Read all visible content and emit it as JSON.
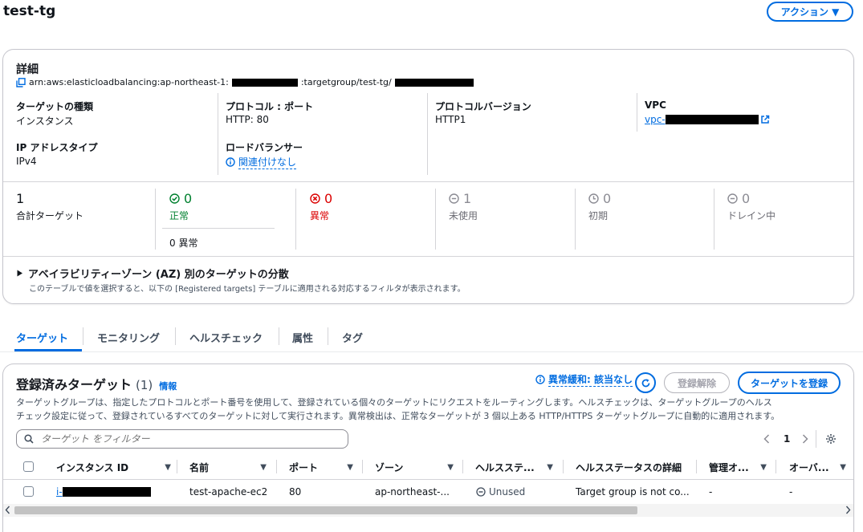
{
  "page": {
    "title": "test-tg",
    "actions_button": "アクション ▼"
  },
  "details": {
    "heading": "詳細",
    "arn_prefix": "arn:aws:elasticloadbalancing:ap-northeast-1:",
    "arn_mid": ":targetgroup/test-tg/",
    "fields": {
      "target_type_label": "ターゲットの種類",
      "target_type_value": "インスタンス",
      "protocol_port_label": "プロトコル : ポート",
      "protocol_port_value": "HTTP: 80",
      "protocol_version_label": "プロトコルバージョン",
      "protocol_version_value": "HTTP1",
      "vpc_label": "VPC",
      "vpc_value_prefix": "vpc-",
      "ip_type_label": "IP アドレスタイプ",
      "ip_type_value": "IPv4",
      "lb_label": "ロードバランサー",
      "lb_value": "関連付けなし"
    },
    "stats": {
      "total_count": "1",
      "total_label": "合計ターゲット",
      "healthy_count": "0",
      "healthy_label": "正常",
      "anomaly_text": "0 異常",
      "unhealthy_count": "0",
      "unhealthy_label": "異常",
      "unused_count": "1",
      "unused_label": "未使用",
      "initial_count": "0",
      "initial_label": "初期",
      "draining_count": "0",
      "draining_label": "ドレイン中"
    },
    "az_section": {
      "title": "アベイラビリティーゾーン (AZ) 別のターゲットの分散",
      "desc": "このテーブルで値を選択すると、以下の [Registered targets] テーブルに適用される対応するフィルタが表示されます。"
    }
  },
  "tabs": [
    "ターゲット",
    "モニタリング",
    "ヘルスチェック",
    "属性",
    "タグ"
  ],
  "registered": {
    "title": "登録済みターゲット",
    "count": "(1)",
    "info": "情報",
    "mitigation": "異常緩和: 該当なし",
    "deregister_btn": "登録解除",
    "register_btn": "ターゲットを登録",
    "desc_line1": "ターゲットグループは、指定したプロトコルとポート番号を使用して、登録されている個々のターゲットにリクエストをルーティングします。ヘルスチェックは、ターゲットグループのヘルス",
    "desc_line2": "チェック設定に従って、登録されているすべてのターゲットに対して実行されます。異常検出は、正常なターゲットが 3 個以上ある HTTP/HTTPS ターゲットグループに自動的に適用されます。",
    "filter_placeholder": "ターゲット をフィルター",
    "page_number": "1",
    "columns": [
      "インスタンス ID",
      "名前",
      "ポート",
      "ゾーン",
      "ヘルスステ...",
      "ヘルスステータスの詳細",
      "管理オ...",
      "オーバ..."
    ],
    "row": {
      "instance_prefix": "i-",
      "name": "test-apache-ec2",
      "port": "80",
      "zone": "ap-northeast-...",
      "health": "Unused",
      "health_detail": "Target group is not co...",
      "admin": "-",
      "override": "-"
    }
  },
  "colors": {
    "accent": "#006ce0",
    "healthy": "#00802f",
    "unhealthy": "#db0000",
    "muted": "#8c8c94"
  },
  "icons": [
    "copy-icon",
    "external-link-icon",
    "info-icon",
    "check-circle-icon",
    "x-circle-icon",
    "minus-circle-icon",
    "clock-icon",
    "refresh-icon",
    "search-icon",
    "settings-icon",
    "caret-down-icon",
    "chevron-left-icon",
    "chevron-right-icon"
  ]
}
